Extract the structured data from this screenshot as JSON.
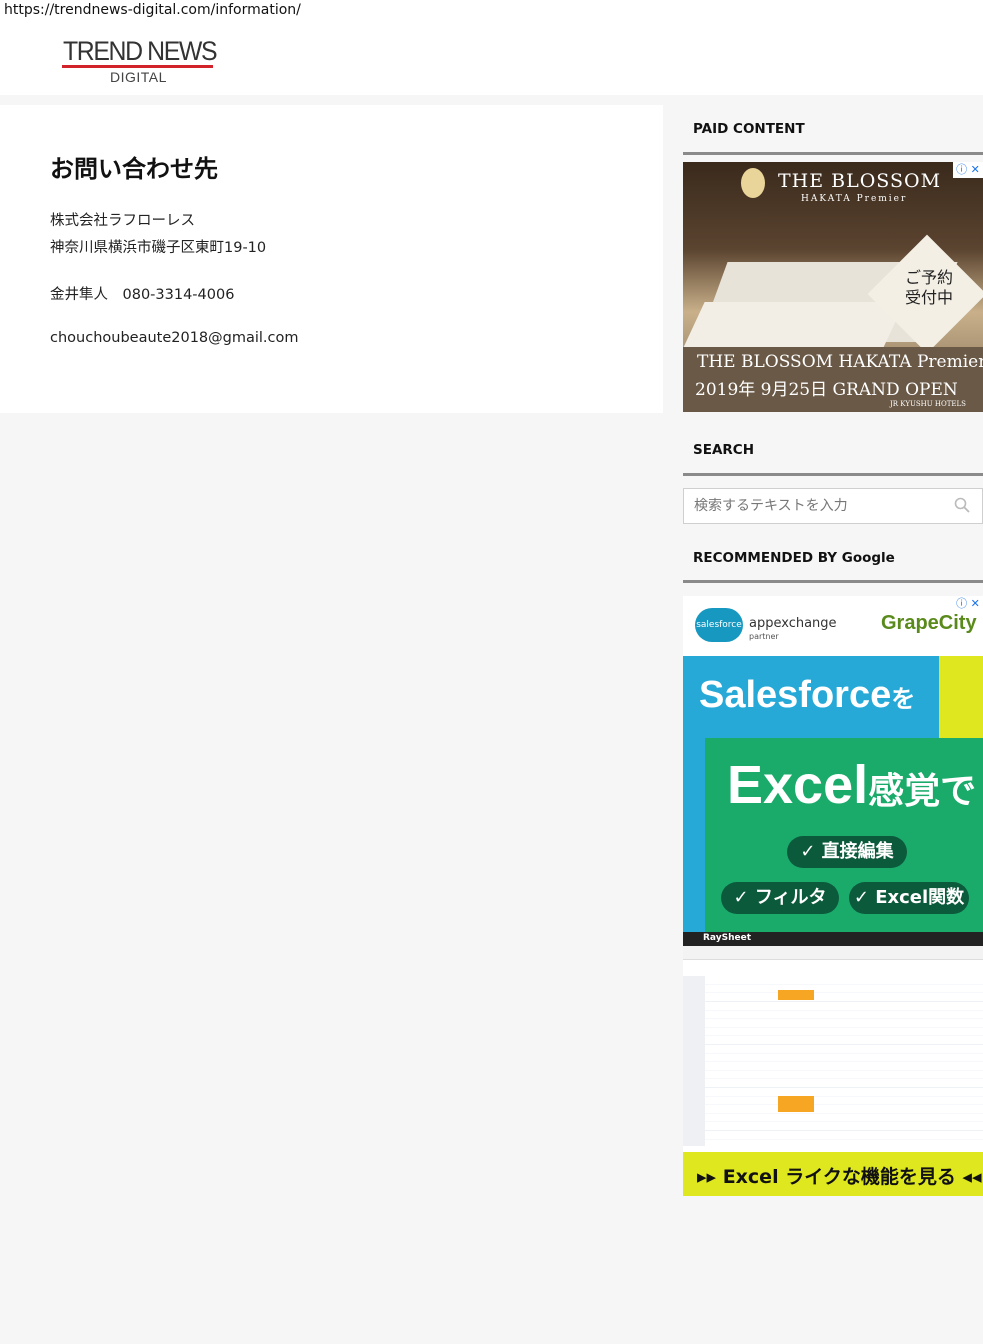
{
  "browser": {
    "url": "https://trendnews-digital.com/information/"
  },
  "site": {
    "logo_main": "TREND NEWS",
    "logo_sub": "DIGITAL"
  },
  "page": {
    "title": "お問い合わせ先",
    "company": "株式会社ラフローレス",
    "address": "神奈川県横浜市磯子区東町19-10",
    "contact": "金井隼人　080-3314-4006",
    "email": "chouchoubeaute2018@gmail.com"
  },
  "sidebar": {
    "paid_heading": "PAID CONTENT",
    "search_heading": "SEARCH",
    "search_placeholder": "検索するテキストを入力",
    "recommended_heading": "RECOMMENDED BY Google"
  },
  "ad1": {
    "brand": "THE BLOSSOM",
    "brand_sub": "HAKATA Premier",
    "badge": "ご予約\n受付中",
    "line1": "THE BLOSSOM HAKATA Premier",
    "line2": "2019年 9月25日  GRAND OPEN",
    "line3": "JR KYUSHU HOTELS",
    "close": "ⓘ ✕"
  },
  "ad2": {
    "sf_logo": "salesforce",
    "appexchange": "appexchange",
    "partner": "partner",
    "grapecity": "GrapeCity",
    "headline1": "Salesforce",
    "headline1_suffix": "を",
    "headline2": "Excel",
    "headline2_suffix": "感覚で",
    "pill1": "✓ 直接編集",
    "pill2": "✓ フィルタ",
    "pill3": "✓ Excel関数",
    "app_name": "RaySheet",
    "cta": "▸▸ Excel ライクな機能を見る ◂◂",
    "close": "ⓘ ✕"
  }
}
